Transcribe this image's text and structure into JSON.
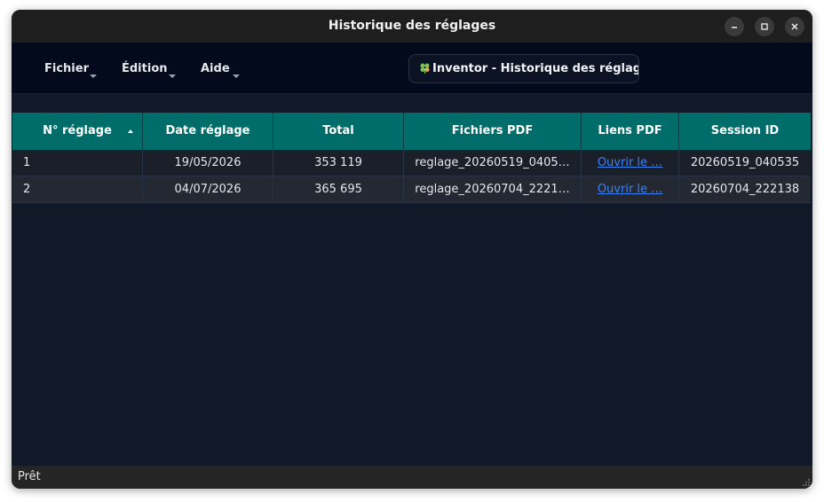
{
  "window": {
    "title": "Historique des réglages"
  },
  "menu": {
    "items": [
      {
        "label": "Fichier"
      },
      {
        "label": "Édition"
      },
      {
        "label": "Aide"
      }
    ]
  },
  "app_badge": {
    "icon": "leaf-icon",
    "text": "Inventor - Historique des réglages"
  },
  "table": {
    "columns": [
      {
        "label": "N° réglage",
        "sorted": "ascending"
      },
      {
        "label": "Date réglage"
      },
      {
        "label": "Total"
      },
      {
        "label": "Fichiers PDF"
      },
      {
        "label": "Liens PDF"
      },
      {
        "label": "Session ID"
      }
    ],
    "rows": [
      {
        "id": "1",
        "date": "19/05/2026",
        "total": "353 119",
        "pdf": "reglage_20260519_0405…",
        "link": "Ouvrir le …",
        "session": "20260519_040535"
      },
      {
        "id": "2",
        "date": "04/07/2026",
        "total": "365 695",
        "pdf": "reglage_20260704_2221…",
        "link": "Ouvrir le …",
        "session": "20260704_222138"
      }
    ]
  },
  "status": {
    "text": "Prêt"
  },
  "colors": {
    "header_bg": "#006d6a",
    "window_bg": "#111827",
    "link": "#3b82f6"
  }
}
